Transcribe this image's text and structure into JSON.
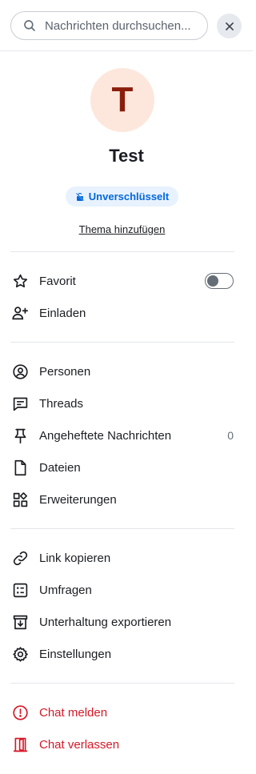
{
  "search": {
    "placeholder": "Nachrichten durchsuchen..."
  },
  "room": {
    "avatar_letter": "T",
    "name": "Test",
    "encryption_label": "Unverschlüsselt",
    "topic_link": "Thema hinzufügen"
  },
  "sections": {
    "favorites": {
      "favorite_label": "Favorit",
      "favorite_enabled": false,
      "invite_label": "Einladen"
    },
    "info": {
      "people": "Personen",
      "threads": "Threads",
      "pinned": "Angeheftete Nachrichten",
      "pinned_count": "0",
      "files": "Dateien",
      "extensions": "Erweiterungen"
    },
    "actions": {
      "copy_link": "Link kopieren",
      "polls": "Umfragen",
      "export": "Unterhaltung exportieren",
      "settings": "Einstellungen"
    },
    "danger": {
      "report": "Chat melden",
      "leave": "Chat verlassen"
    }
  },
  "colors": {
    "accent": "#0467dd",
    "danger": "#d51928",
    "avatar_bg": "#fde7dc",
    "avatar_fg": "#8a1e0b"
  },
  "icons": [
    "search-icon",
    "close-icon",
    "crossed-lock-icon",
    "star-icon",
    "add-user-icon",
    "user-circle-icon",
    "threads-icon",
    "pin-icon",
    "file-icon",
    "extensions-icon",
    "link-icon",
    "poll-icon",
    "export-icon",
    "gear-icon",
    "error-icon",
    "leave-door-icon"
  ]
}
